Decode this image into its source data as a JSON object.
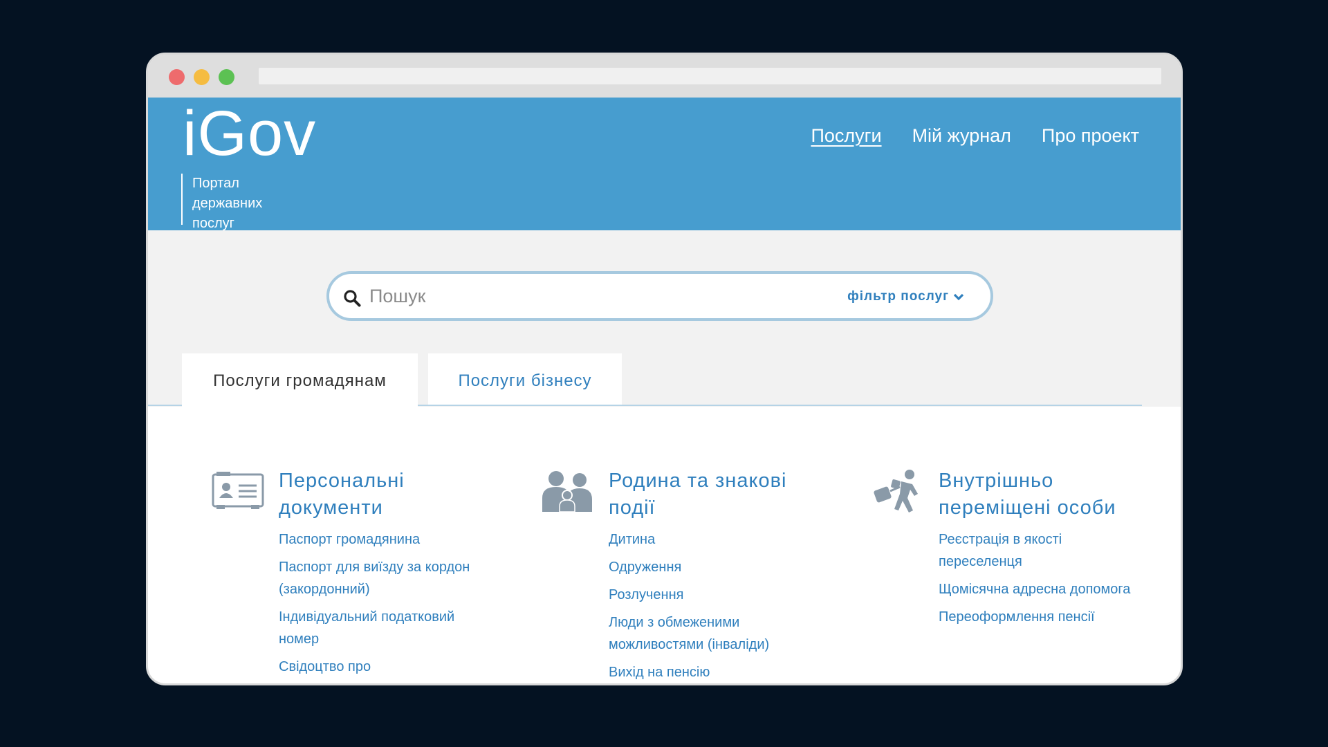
{
  "header": {
    "logo": "iGov",
    "tagline": "Портал державних послуг",
    "nav": [
      {
        "label": "Послуги",
        "active": true
      },
      {
        "label": "Мій журнал",
        "active": false
      },
      {
        "label": "Про проект",
        "active": false
      }
    ]
  },
  "search": {
    "placeholder": "Пошук",
    "filter_label": "фільтр послуг",
    "icon": "search-icon"
  },
  "tabs": [
    {
      "label": "Послуги громадянам",
      "active": true
    },
    {
      "label": "Послуги бізнесу",
      "active": false
    }
  ],
  "categories": [
    {
      "icon": "id-card-icon",
      "title": "Персональні документи",
      "links": [
        "Паспорт громадянина",
        "Паспорт для виїзду за кордон (закордонний)",
        "Індивідуальний податковий номер",
        "Свідоцтво про"
      ]
    },
    {
      "icon": "family-icon",
      "title": "Родина та знакові події",
      "links": [
        "Дитина",
        "Одруження",
        "Розлучення",
        "Люди з обмеженими можливостями (інваліди)",
        "Вихід на пенсію"
      ]
    },
    {
      "icon": "displaced-person-icon",
      "title": "Внутрішньо переміщені особи",
      "links": [
        "Реєстрація в якості переселенця",
        "Щомісячна адресна допомога",
        "Переоформлення пенсії"
      ]
    }
  ],
  "colors": {
    "background": "#041222",
    "header": "#479dcf",
    "link": "#2f7fbd",
    "icon": "#8a9aa8"
  }
}
